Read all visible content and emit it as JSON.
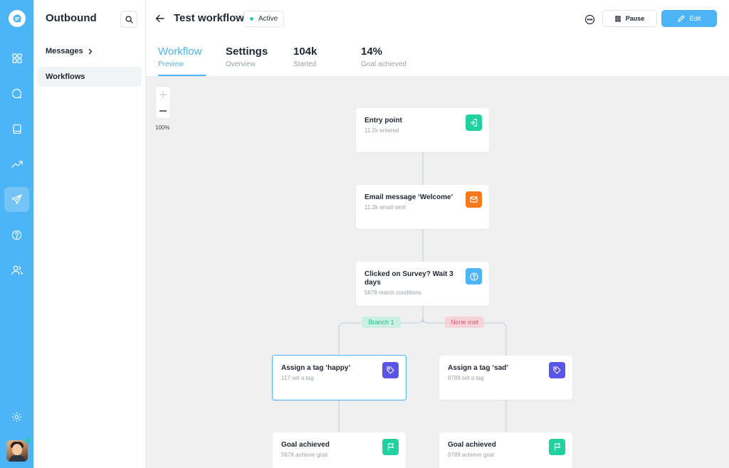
{
  "app": {
    "colors": {
      "accent": "#4db4f5",
      "rail": "#4db4f5",
      "canvas": "#f0f0f0"
    }
  },
  "rail": {
    "icons": [
      "chat-logo-icon",
      "grid-icon",
      "chat-icon",
      "book-icon",
      "trend-icon",
      "send-icon",
      "help-icon",
      "users-icon",
      "settings-icon"
    ],
    "active": "send-icon"
  },
  "sidebar": {
    "title": "Outbound",
    "messages_label": "Messages",
    "workflows_label": "Workflows"
  },
  "header": {
    "title": "Test workflow",
    "status": "Active",
    "pause_label": "Pause",
    "edit_label": "Edit",
    "tabs": [
      {
        "label": "Workflow",
        "sub": "Preview"
      },
      {
        "label": "Settings",
        "sub": "Overview"
      },
      {
        "label": "104k",
        "sub": "Started"
      },
      {
        "label": "14%",
        "sub": "Goal achieved"
      }
    ],
    "active_tab": 0
  },
  "canvas": {
    "zoom_level": "100%",
    "branch_yes": "Branch 1",
    "branch_no": "None met",
    "nodes": [
      {
        "title": "Entry point",
        "sub": "11.2k entered",
        "icon": "entry-icon",
        "icon_color": "#21d19f"
      },
      {
        "title": "Email message ‘Welcome’",
        "sub": "11.2k email sent",
        "icon": "mail-icon",
        "icon_color": "#f57a1b"
      },
      {
        "title": "Clicked on Survey? Wait 3 days",
        "sub": "5678 match conditions",
        "icon": "question-icon",
        "icon_color": "#4db4f5"
      },
      {
        "title": "Assign a tag ‘happy’",
        "sub": "117 set a tag",
        "icon": "tag-icon",
        "icon_color": "#5b54e8"
      },
      {
        "title": "Assign a tag ‘sad’",
        "sub": "6789 set a tag",
        "icon": "tag-icon",
        "icon_color": "#5b54e8"
      },
      {
        "title": "Goal achieved",
        "sub": "5678 achieve goal",
        "icon": "flag-icon",
        "icon_color": "#21d19f"
      },
      {
        "title": "Goal achieved",
        "sub": "6789 achieve goal",
        "icon": "flag-icon",
        "icon_color": "#21d19f"
      }
    ]
  }
}
